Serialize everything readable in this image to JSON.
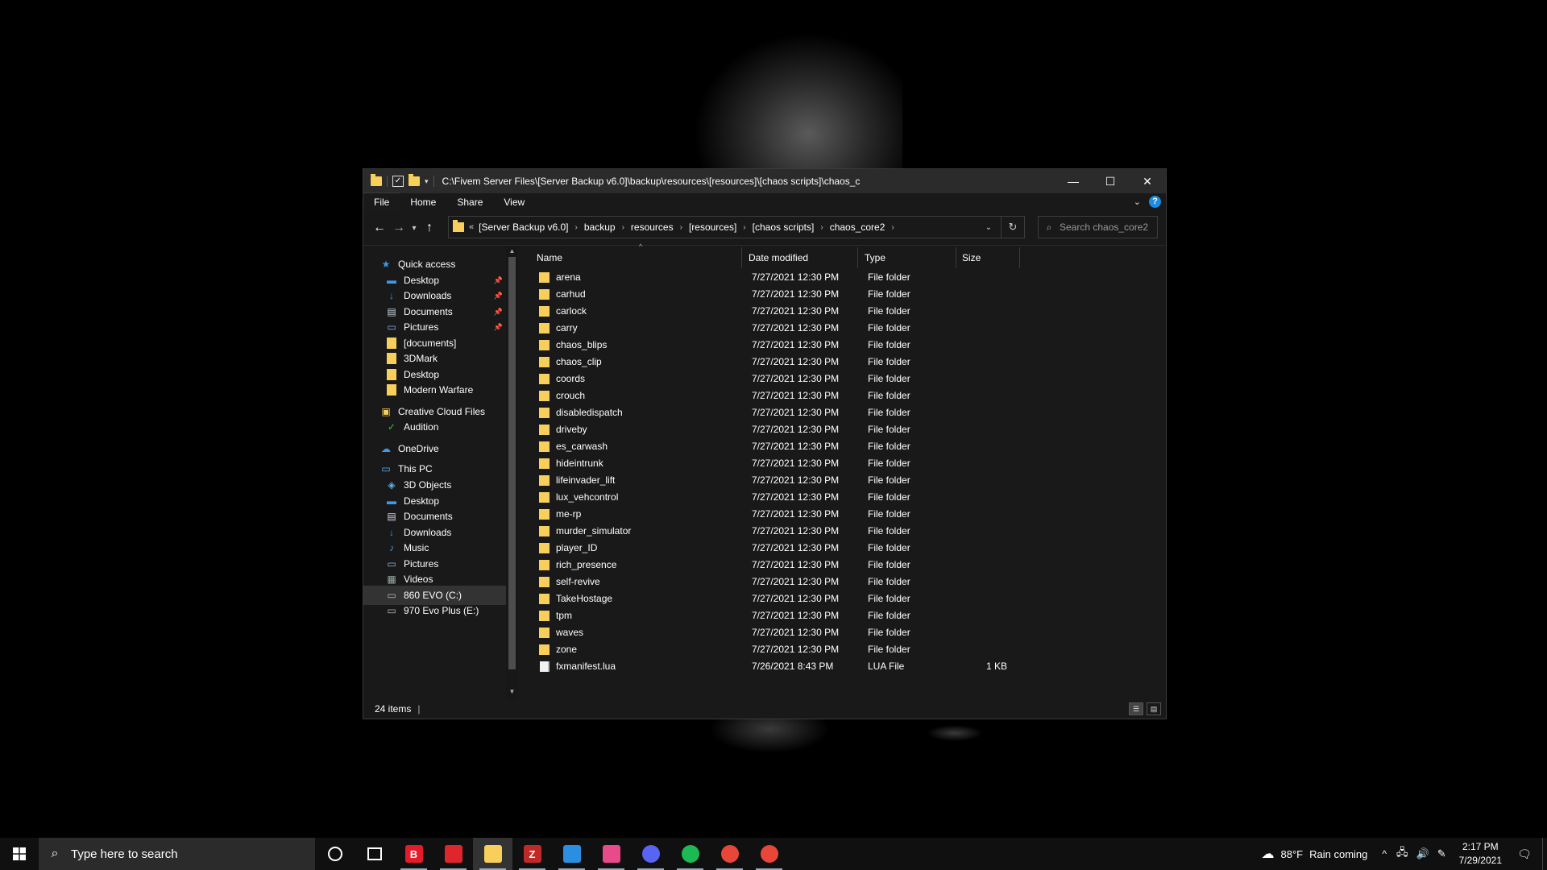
{
  "window": {
    "title_path": "C:\\Fivem Server Files\\[Server Backup v6.0]\\backup\\resources\\[resources]\\[chaos scripts]\\chaos_c",
    "controls": {
      "minimize": "—",
      "maximize": "☐",
      "close": "✕"
    }
  },
  "ribbon": {
    "tabs": [
      "File",
      "Home",
      "Share",
      "View"
    ],
    "help": "?"
  },
  "address": {
    "lead": "«",
    "crumbs": [
      "[Server Backup v6.0]",
      "backup",
      "resources",
      "[resources]",
      "[chaos scripts]",
      "chaos_core2"
    ],
    "search_placeholder": "Search chaos_core2"
  },
  "sidebar": {
    "items": [
      {
        "label": "Quick access",
        "icon": "star-icon"
      },
      {
        "label": "Desktop",
        "icon": "desktop-icon",
        "pinned": true
      },
      {
        "label": "Downloads",
        "icon": "download-icon",
        "pinned": true
      },
      {
        "label": "Documents",
        "icon": "documents-icon",
        "pinned": true
      },
      {
        "label": "Pictures",
        "icon": "pictures-icon",
        "pinned": true
      },
      {
        "label": "[documents]",
        "icon": "folder-icon"
      },
      {
        "label": "3DMark",
        "icon": "folder-icon"
      },
      {
        "label": "Desktop",
        "icon": "folder-icon"
      },
      {
        "label": "Modern Warfare",
        "icon": "folder-icon"
      },
      {
        "label": "Creative Cloud Files",
        "icon": "creative-cloud-icon"
      },
      {
        "label": "Audition",
        "icon": "folder-sync-icon"
      },
      {
        "label": "OneDrive",
        "icon": "cloud-icon"
      },
      {
        "label": "This PC",
        "icon": "computer-icon"
      },
      {
        "label": "3D Objects",
        "icon": "3d-objects-icon"
      },
      {
        "label": "Desktop",
        "icon": "desktop-icon"
      },
      {
        "label": "Documents",
        "icon": "documents-icon"
      },
      {
        "label": "Downloads",
        "icon": "download-icon"
      },
      {
        "label": "Music",
        "icon": "music-icon"
      },
      {
        "label": "Pictures",
        "icon": "pictures-icon"
      },
      {
        "label": "Videos",
        "icon": "videos-icon"
      },
      {
        "label": "860 EVO (C:)",
        "icon": "drive-icon",
        "selected": true
      },
      {
        "label": "970 Evo Plus (E:)",
        "icon": "drive-icon"
      }
    ]
  },
  "columns": {
    "name": "Name",
    "date": "Date modified",
    "type": "Type",
    "size": "Size"
  },
  "files": [
    {
      "name": "arena",
      "date": "7/27/2021 12:30 PM",
      "type": "File folder",
      "size": ""
    },
    {
      "name": "carhud",
      "date": "7/27/2021 12:30 PM",
      "type": "File folder",
      "size": ""
    },
    {
      "name": "carlock",
      "date": "7/27/2021 12:30 PM",
      "type": "File folder",
      "size": ""
    },
    {
      "name": "carry",
      "date": "7/27/2021 12:30 PM",
      "type": "File folder",
      "size": ""
    },
    {
      "name": "chaos_blips",
      "date": "7/27/2021 12:30 PM",
      "type": "File folder",
      "size": ""
    },
    {
      "name": "chaos_clip",
      "date": "7/27/2021 12:30 PM",
      "type": "File folder",
      "size": ""
    },
    {
      "name": "coords",
      "date": "7/27/2021 12:30 PM",
      "type": "File folder",
      "size": ""
    },
    {
      "name": "crouch",
      "date": "7/27/2021 12:30 PM",
      "type": "File folder",
      "size": ""
    },
    {
      "name": "disabledispatch",
      "date": "7/27/2021 12:30 PM",
      "type": "File folder",
      "size": ""
    },
    {
      "name": "driveby",
      "date": "7/27/2021 12:30 PM",
      "type": "File folder",
      "size": ""
    },
    {
      "name": "es_carwash",
      "date": "7/27/2021 12:30 PM",
      "type": "File folder",
      "size": ""
    },
    {
      "name": "hideintrunk",
      "date": "7/27/2021 12:30 PM",
      "type": "File folder",
      "size": ""
    },
    {
      "name": "lifeinvader_lift",
      "date": "7/27/2021 12:30 PM",
      "type": "File folder",
      "size": ""
    },
    {
      "name": "lux_vehcontrol",
      "date": "7/27/2021 12:30 PM",
      "type": "File folder",
      "size": ""
    },
    {
      "name": "me-rp",
      "date": "7/27/2021 12:30 PM",
      "type": "File folder",
      "size": ""
    },
    {
      "name": "murder_simulator",
      "date": "7/27/2021 12:30 PM",
      "type": "File folder",
      "size": ""
    },
    {
      "name": "player_ID",
      "date": "7/27/2021 12:30 PM",
      "type": "File folder",
      "size": ""
    },
    {
      "name": "rich_presence",
      "date": "7/27/2021 12:30 PM",
      "type": "File folder",
      "size": ""
    },
    {
      "name": "self-revive",
      "date": "7/27/2021 12:30 PM",
      "type": "File folder",
      "size": ""
    },
    {
      "name": "TakeHostage",
      "date": "7/27/2021 12:30 PM",
      "type": "File folder",
      "size": ""
    },
    {
      "name": "tpm",
      "date": "7/27/2021 12:30 PM",
      "type": "File folder",
      "size": ""
    },
    {
      "name": "waves",
      "date": "7/27/2021 12:30 PM",
      "type": "File folder",
      "size": ""
    },
    {
      "name": "zone",
      "date": "7/27/2021 12:30 PM",
      "type": "File folder",
      "size": ""
    },
    {
      "name": "fxmanifest.lua",
      "date": "7/26/2021 8:43 PM",
      "type": "LUA File",
      "size": "1 KB"
    }
  ],
  "status": {
    "item_count": "24 items"
  },
  "taskbar": {
    "search_placeholder": "Type here to search",
    "apps": [
      {
        "name": "cortana-icon"
      },
      {
        "name": "task-view-icon"
      },
      {
        "name": "bitdefender-icon",
        "color": "#e31c2a",
        "glyph": "B"
      },
      {
        "name": "red-app-icon",
        "color": "#e0262d"
      },
      {
        "name": "file-explorer-icon",
        "color": "#f7cf5a"
      },
      {
        "name": "filezilla-icon",
        "color": "#bf2a26",
        "glyph": "Z"
      },
      {
        "name": "vscode-icon",
        "color": "#2a8fe0"
      },
      {
        "name": "creative-app-icon",
        "color": "#e84a8a"
      },
      {
        "name": "discord-icon",
        "color": "#5865f2"
      },
      {
        "name": "spotify-icon",
        "color": "#1db954"
      },
      {
        "name": "chrome-icon",
        "color": "#e9463a"
      },
      {
        "name": "chrome-icon-2",
        "color": "#e9463a"
      }
    ],
    "weather": {
      "temp": "88°F",
      "text": "Rain coming"
    },
    "time": "2:17 PM",
    "date": "7/29/2021"
  }
}
